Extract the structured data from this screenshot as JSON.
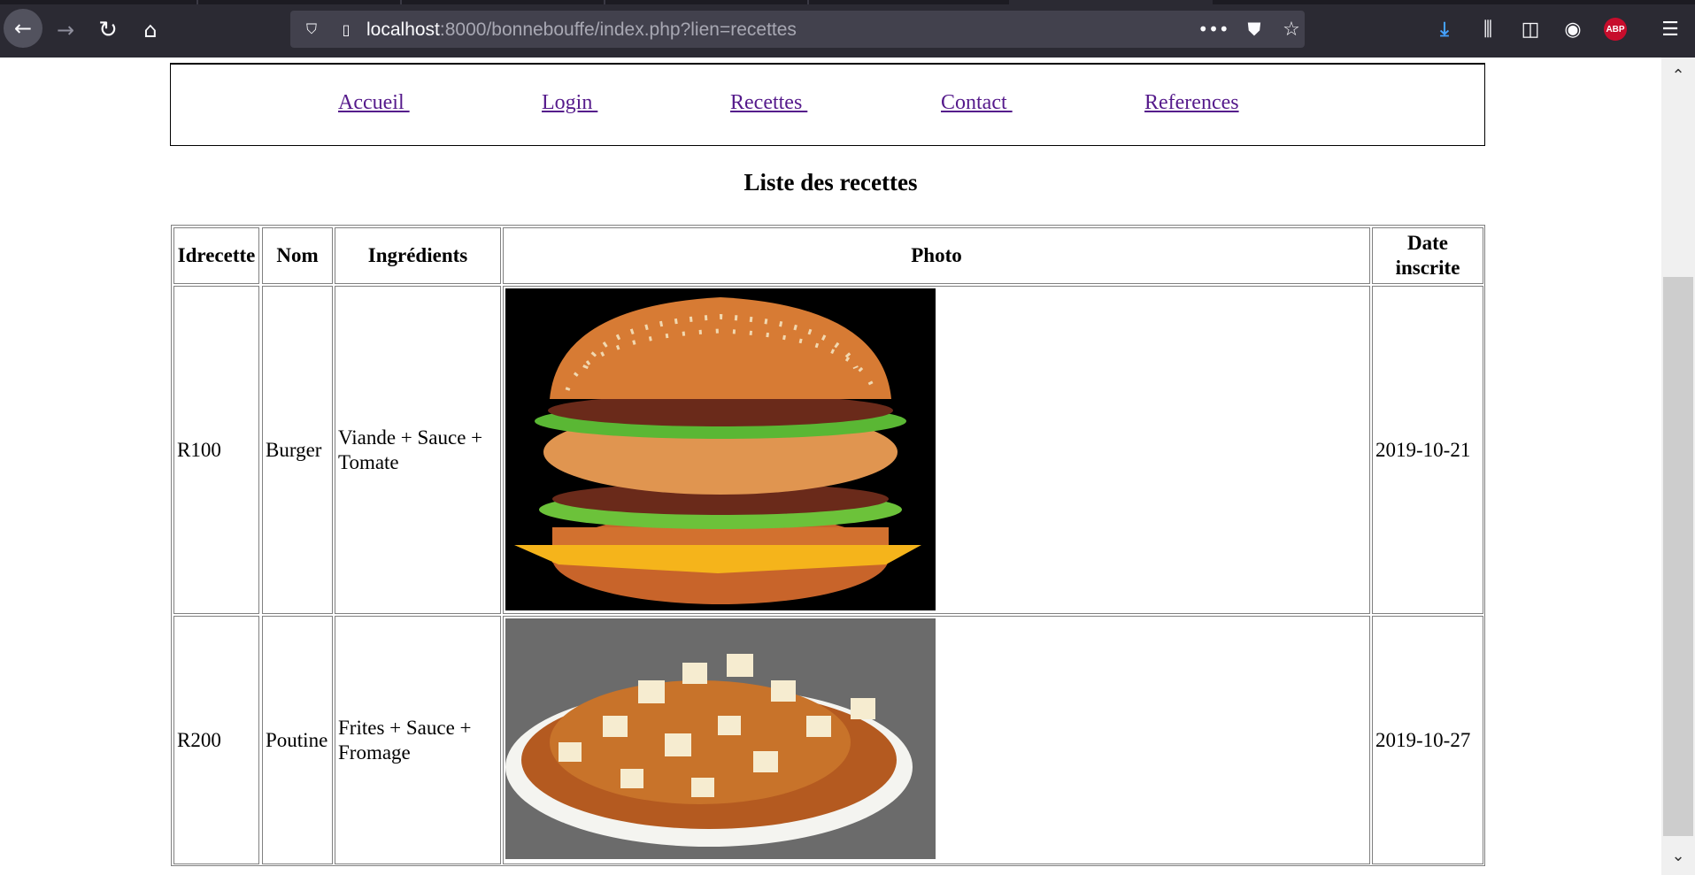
{
  "browser": {
    "url_host": "localhost",
    "url_rest": ":8000/bonnebouffe/index.php?lien=recettes",
    "icons": [
      "back-icon",
      "forward-icon",
      "reload-icon",
      "home-icon",
      "shield-icon",
      "page-icon",
      "more-icon",
      "pocket-icon",
      "star-icon",
      "download-icon",
      "library-icon",
      "sidebar-icon",
      "account-icon",
      "adblock-icon",
      "menu-icon"
    ],
    "adblock_badge": "ABP"
  },
  "nav": {
    "accueil": "Accueil ",
    "login": "Login ",
    "recettes": "Recettes ",
    "contact": "Contact ",
    "references": "References"
  },
  "page_title": "Liste des recettes",
  "table": {
    "headers": {
      "id": "Idrecette",
      "nom": "Nom",
      "ingredients": "Ingrédients",
      "photo": "Photo",
      "date": "Date inscrite"
    },
    "rows": [
      {
        "id": "R100",
        "nom": "Burger",
        "ingredients": "Viande + Sauce + Tomate",
        "photo": "burger-photo",
        "date": "2019-10-21"
      },
      {
        "id": "R200",
        "nom": "Poutine",
        "ingredients": "Frites + Sauce + Fromage",
        "photo": "poutine-photo",
        "date": "2019-10-27"
      }
    ]
  },
  "colors": {
    "chrome_bg": "#2b2a33",
    "urlbar_bg": "#42414d",
    "link_visited": "#551a8b",
    "download_accent": "#45a1ff",
    "adblock_red": "#c70d2c"
  }
}
